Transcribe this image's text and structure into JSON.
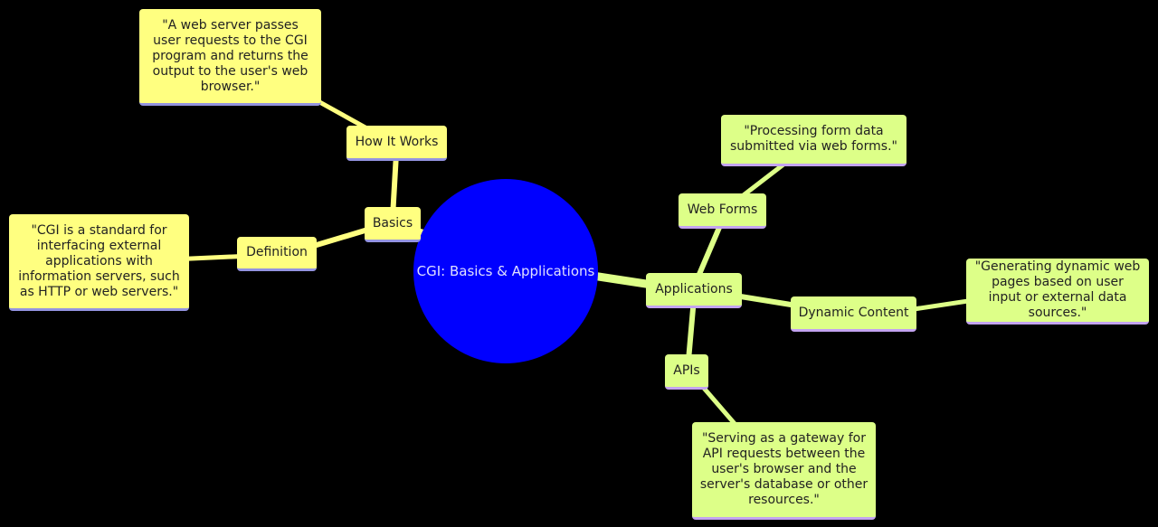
{
  "diagram": {
    "type": "mindmap",
    "colors": {
      "background": "#000000",
      "root": "#0000ff",
      "branch_basics": "#ffff80",
      "branch_applications": "#ddff88"
    },
    "root": {
      "label": "CGI: Basics & Applications"
    },
    "basics": {
      "label": "Basics",
      "how_it_works": {
        "label": "How It Works",
        "detail": "\"A web server passes user requests to the CGI program and returns the output to the user's web browser.\""
      },
      "definition": {
        "label": "Definition",
        "detail": "\"CGI is a standard for interfacing external applications with information servers, such as HTTP or web servers.\""
      }
    },
    "applications": {
      "label": "Applications",
      "web_forms": {
        "label": "Web Forms",
        "detail": "\"Processing form data submitted via web forms.\""
      },
      "dynamic_content": {
        "label": "Dynamic Content",
        "detail": "\"Generating dynamic web pages based on user input or external data sources.\""
      },
      "apis": {
        "label": "APIs",
        "detail": "\"Serving as a gateway for API requests between the user's browser and the server's database or other resources.\""
      }
    }
  }
}
